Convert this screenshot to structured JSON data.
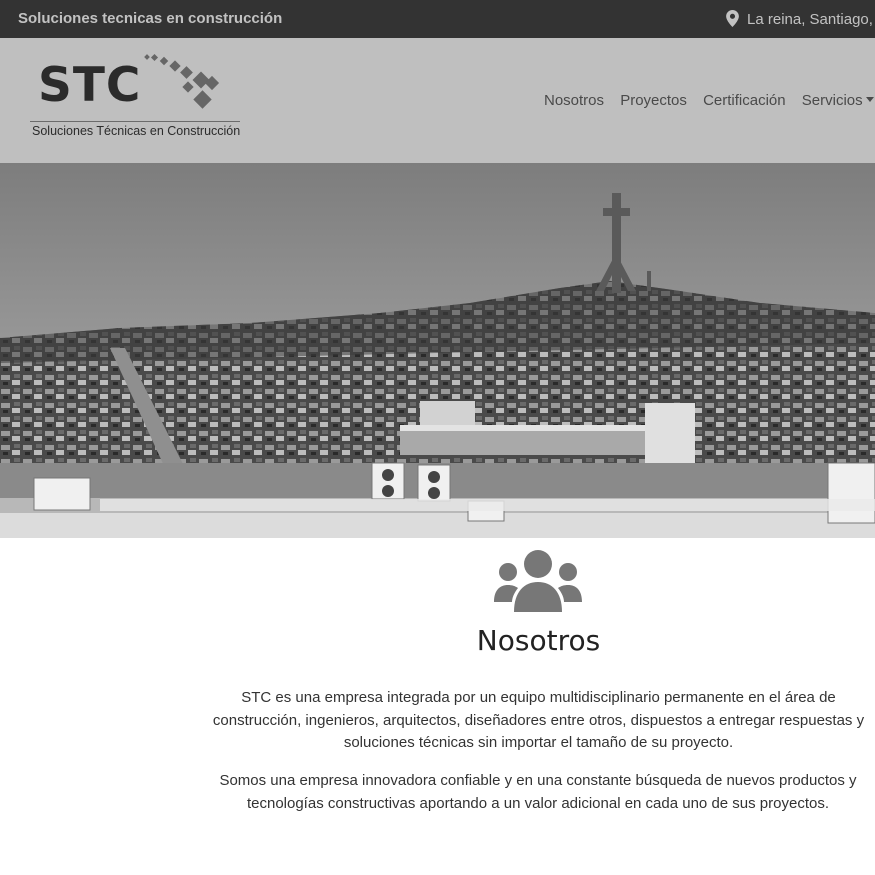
{
  "topbar": {
    "tagline": "Soluciones tecnicas en construcción",
    "location": "La reina, Santiago, Chile",
    "location_icon": "map-marker-icon"
  },
  "brand": {
    "name": "STC",
    "subtitle": "Soluciones Técnicas en Construcción"
  },
  "nav": {
    "items": [
      {
        "label": "Nosotros"
      },
      {
        "label": "Proyectos"
      },
      {
        "label": "Certificación"
      },
      {
        "label": "Servicios"
      }
    ]
  },
  "about": {
    "icon": "users-icon",
    "title": "Nosotros",
    "paragraphs": [
      "STC es una empresa integrada por un equipo multidisciplinario permanente en el área de construcción, ingenieros, arquitectos, diseñadores entre otros, dispuestos a entregar respuestas y soluciones técnicas sin importar el tamaño de su proyecto.",
      "Somos una empresa innovadora confiable y en una constante búsqueda de nuevos productos y tecnologías constructivas aportando a un valor adicional en cada uno de sus proyectos."
    ]
  },
  "colors": {
    "topbar": "#333333",
    "navbar": "#bfbfbf",
    "text": "#333333"
  }
}
